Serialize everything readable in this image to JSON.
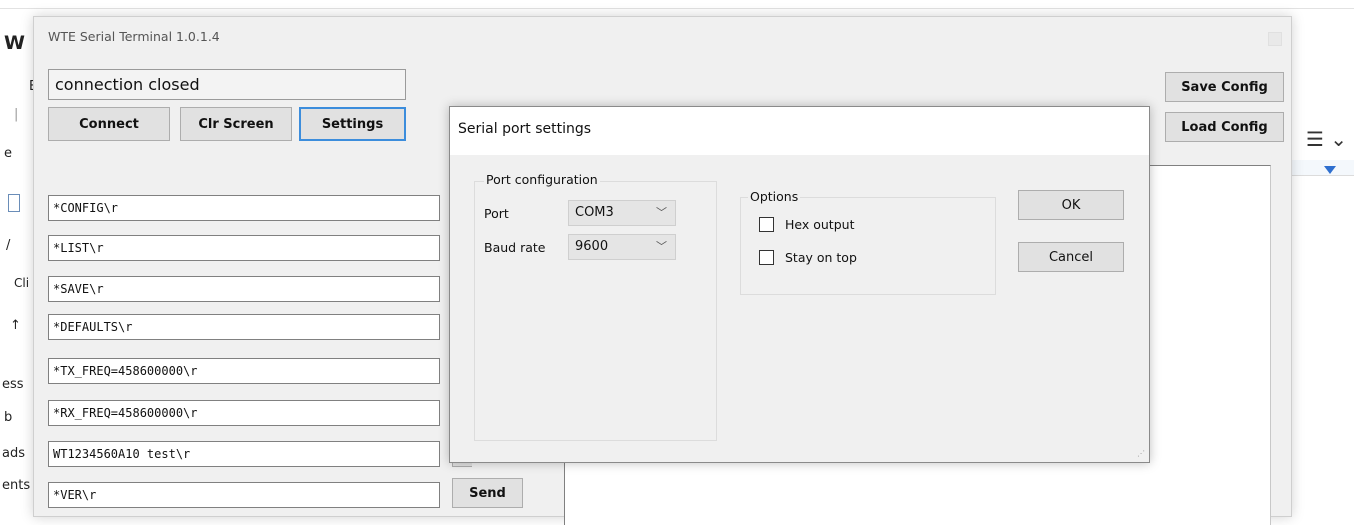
{
  "background_app": {
    "top_fragment": "W",
    "left_fragments": [
      "E",
      "|",
      "e",
      "",
      "/",
      "Cli",
      "↑",
      "ess",
      "b",
      "ads",
      "ents"
    ]
  },
  "window": {
    "title": "WTE Serial Terminal 1.0.1.4"
  },
  "status": "connection closed",
  "toolbar": {
    "connect_label": "Connect",
    "clr_screen_label": "Clr Screen",
    "settings_label": "Settings",
    "save_config_label": "Save Config",
    "load_config_label": "Load Config"
  },
  "commands": [
    "*CONFIG\\r",
    "*LIST\\r",
    "*SAVE\\r",
    "*DEFAULTS\\r",
    "*TX_FREQ=458600000\\r",
    "*RX_FREQ=458600000\\r",
    "WT1234560A10 test\\r",
    "*VER\\r"
  ],
  "send_label": "Send",
  "dialog": {
    "title": "Serial port settings",
    "port_group_label": "Port configuration",
    "port_label": "Port",
    "port_value": "COM3",
    "baud_label": "Baud rate",
    "baud_value": "9600",
    "options_label": "Options",
    "hex_output_label": "Hex output",
    "hex_output_checked": false,
    "stay_on_top_label": "Stay on top",
    "stay_on_top_checked": false,
    "ok_label": "OK",
    "cancel_label": "Cancel"
  },
  "icons": {
    "dropdown": "chevron-down-icon",
    "list_icon": "list-bullets-icon",
    "close": "close-icon",
    "grip": "resize-grip-icon"
  }
}
